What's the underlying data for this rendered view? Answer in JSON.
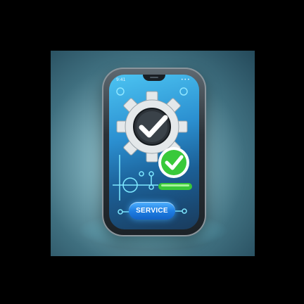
{
  "phone": {
    "status_time": "9:41",
    "status_signal": "•••"
  },
  "icons": {
    "main": "gear-checkmark-icon",
    "badge": "green-checkmark-badge-icon"
  },
  "service_button": {
    "label": "SERVICE"
  },
  "colors": {
    "screen_blue": "#2b8fd0",
    "button_blue": "#1f7fe4",
    "success_green": "#39c93a",
    "gear_grey": "#e4e8ea"
  }
}
